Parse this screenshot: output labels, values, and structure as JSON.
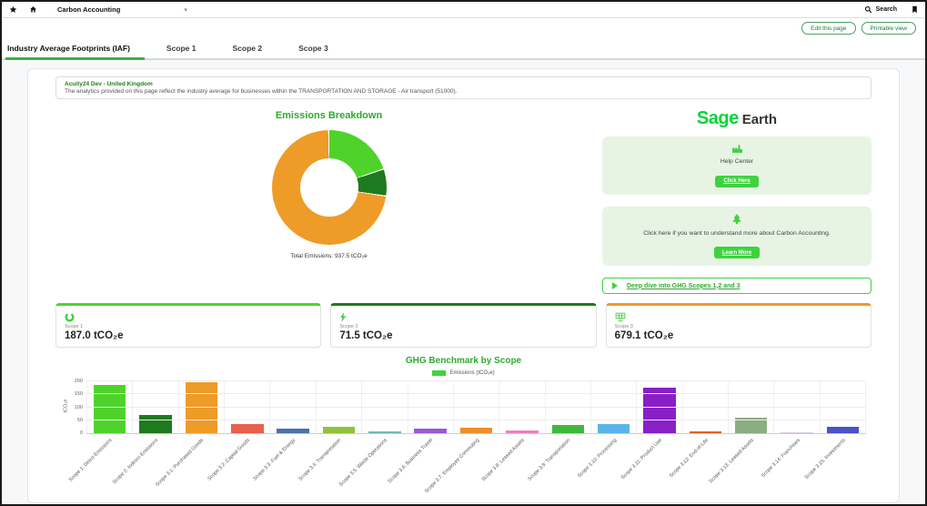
{
  "topbar": {
    "app_switcher": "Carbon Accounting",
    "search_label": "Search"
  },
  "actions": {
    "edit": "Edit this page",
    "printable": "Printable view"
  },
  "tabs": [
    {
      "label": "Industry Average Footprints (IAF)",
      "active": true
    },
    {
      "label": "Scope 1",
      "active": false
    },
    {
      "label": "Scope 2",
      "active": false
    },
    {
      "label": "Scope 3",
      "active": false
    }
  ],
  "info_banner": {
    "title": "Acuity24 Dev - United Kingdom",
    "body": "The analytics provided on this page reflect the industry average for businesses within the TRANSPORTATION AND STORAGE - Air transport (51000)."
  },
  "logo": {
    "brand": "Sage",
    "suffix": "Earth"
  },
  "help_center": {
    "label": "Help Center",
    "button": "Click Here"
  },
  "learn_more": {
    "text": "Click here if you want to understand more about Carbon Accounting.",
    "button": "Learn More"
  },
  "deep_dive": {
    "label": "Deep dive into GHG Scopes 1,2 and 3"
  },
  "scope_cards": [
    {
      "label": "Scope 1",
      "value": "187.0 tCO₂e",
      "accent": "#4fd32b",
      "icon": "ring"
    },
    {
      "label": "Scope 2",
      "value": "71.5 tCO₂e",
      "accent": "#1e7a1e",
      "icon": "bolt"
    },
    {
      "label": "Scope 3",
      "value": "679.1 tCO₂e",
      "accent": "#f0982d",
      "icon": "solar-panel"
    }
  ],
  "chart_data": [
    {
      "type": "pie",
      "subtype": "donut",
      "title": "Emissions Breakdown",
      "labels": [
        "Scope 1",
        "Scope 2",
        "Scope 3"
      ],
      "values": [
        187.0,
        71.5,
        679.1
      ],
      "colors": [
        "#4fd32b",
        "#1e7a1e",
        "#ef9b28"
      ],
      "total_label": "Total Emissions: 937.5 tCO₂e",
      "legend_position": "none"
    },
    {
      "type": "bar",
      "title": "GHG Benchmark by Scope",
      "legend": "Emissions (tCO₂e)",
      "legend_color": "#3fd23f",
      "ylabel": "tCO₂e",
      "ylim": [
        0,
        200
      ],
      "yticks": [
        0,
        50,
        100,
        150,
        200
      ],
      "grid": true,
      "categories": [
        "Scope 1: Direct Emissions",
        "Scope 2: Indirect Emissions",
        "Scope 3.1: Purchased Goods",
        "Scope 3.2: Capital Goods",
        "Scope 3.3: Fuel & Energy",
        "Scope 3.4: Transportation",
        "Scope 3.5: Waste Operations",
        "Scope 3.6: Business Travel",
        "Scope 3.7: Employee Commuting",
        "Scope 3.8: Leased Assets",
        "Scope 3.9: Transportation",
        "Scope 3.10: Processing",
        "Scope 3.11: Product Use",
        "Scope 3.12: End-of-Life",
        "Scope 3.13: Leased Assets",
        "Scope 3.14: Franchises",
        "Scope 3.15: Investments"
      ],
      "values": [
        187,
        71.5,
        195,
        35,
        18,
        26,
        8,
        18,
        20,
        10,
        30,
        35,
        175,
        8,
        60,
        3,
        25
      ],
      "colors": [
        "#4fd32b",
        "#1e7a1e",
        "#ef9b28",
        "#e8604c",
        "#4a72b0",
        "#8fc33a",
        "#76b7b2",
        "#9b59d0",
        "#ef8e2a",
        "#ee7fc0",
        "#3cb93c",
        "#5ab4ea",
        "#8a1fc8",
        "#e06327",
        "#8aad84",
        "#d9c7ec",
        "#4a52cc"
      ]
    }
  ]
}
